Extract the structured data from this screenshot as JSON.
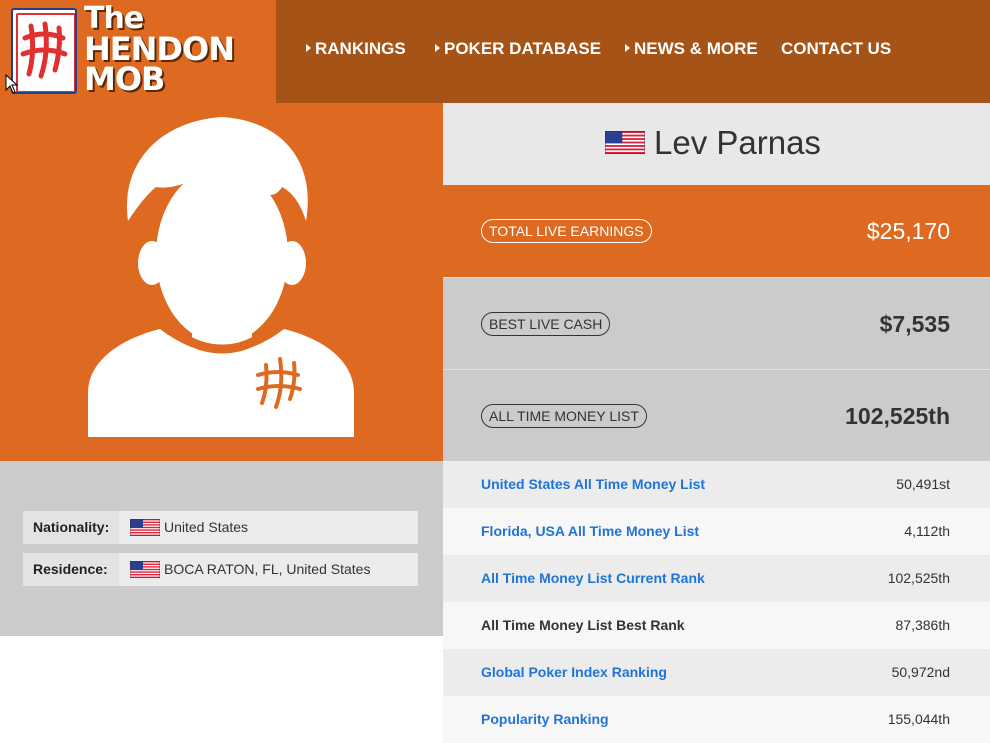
{
  "brand": {
    "logo_lines": [
      "The",
      "HENDON",
      "MOB"
    ],
    "primary_color": "#de6a21",
    "header_color": "#a65318",
    "link_color": "#1f74d6"
  },
  "nav": {
    "items": [
      {
        "label": "RANKINGS",
        "has_arrow": true
      },
      {
        "label": "POKER DATABASE",
        "has_arrow": true
      },
      {
        "label": "NEWS & MORE",
        "has_arrow": true
      },
      {
        "label": "CONTACT US",
        "has_arrow": false
      }
    ]
  },
  "player": {
    "name": "Lev Parnas",
    "flag_icon": "us-flag-icon",
    "avatar_icon": "player-silhouette-icon"
  },
  "details": {
    "nationality_label": "Nationality:",
    "nationality_value": "United States",
    "residence_label": "Residence:",
    "residence_value": "BOCA RATON, FL, United States"
  },
  "stats": {
    "total_live_earnings_label": "TOTAL LIVE EARNINGS",
    "total_live_earnings_value": "$25,170",
    "best_live_cash_label": "BEST LIVE CASH",
    "best_live_cash_value": "$7,535",
    "all_time_money_list_label": "ALL TIME MONEY LIST",
    "all_time_money_list_value": "102,525th"
  },
  "rankings": [
    {
      "label": "United States All Time Money List",
      "value": "50,491st",
      "link": true
    },
    {
      "label": "Florida, USA All Time Money List",
      "value": "4,112th",
      "link": true
    },
    {
      "label": "All Time Money List Current Rank",
      "value": "102,525th",
      "link": true
    },
    {
      "label": "All Time Money List Best Rank",
      "value": "87,386th",
      "link": false
    },
    {
      "label": "Global Poker Index Ranking",
      "value": "50,972nd",
      "link": true
    },
    {
      "label": "Popularity Ranking",
      "value": "155,044th",
      "link": true
    }
  ]
}
